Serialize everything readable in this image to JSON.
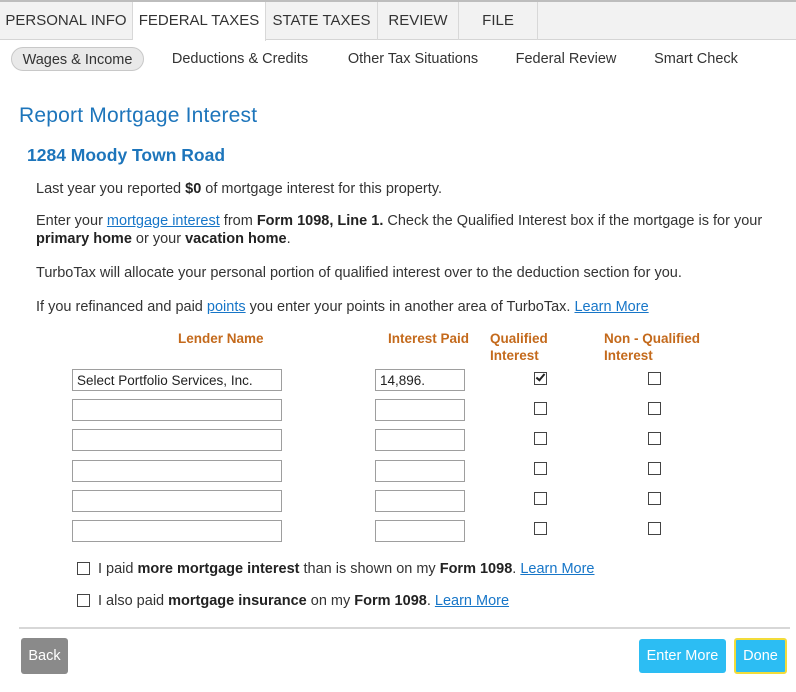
{
  "top_tabs": [
    {
      "label": "PERSONAL INFO"
    },
    {
      "label": "FEDERAL TAXES"
    },
    {
      "label": "STATE TAXES"
    },
    {
      "label": "REVIEW"
    },
    {
      "label": "FILE"
    }
  ],
  "sub_tabs": [
    {
      "label": "Wages & Income"
    },
    {
      "label": "Deductions & Credits"
    },
    {
      "label": "Other Tax Situations"
    },
    {
      "label": "Federal Review"
    },
    {
      "label": "Smart Check"
    }
  ],
  "page": {
    "title": "Report Mortgage Interest",
    "property": "1284 Moody Town Road"
  },
  "paragraphs": {
    "p1": {
      "pre": "Last year you reported ",
      "amount": "$0",
      "post": " of mortgage interest for this property."
    },
    "p2": {
      "pre": "Enter your ",
      "link": "mortgage interest",
      "mid": " from ",
      "form": "Form 1098, Line 1.",
      "mid2": " Check the Qualified Interest box if the mortgage is for your ",
      "primary": "primary home",
      "mid3": " or your ",
      "vacation": "vacation home",
      "end": "."
    },
    "p3": "TurboTax will allocate your personal portion of qualified interest over to the deduction section for you.",
    "p4": {
      "pre": "If you refinanced and paid ",
      "link": "points",
      "mid": " you enter your points in another area of TurboTax. ",
      "learn": "Learn More"
    }
  },
  "table": {
    "headers": {
      "lender": "Lender Name",
      "interest": "Interest Paid",
      "qualified_1": "Qualified",
      "qualified_2": "Interest",
      "nonqualified_1": "Non - Qualified",
      "nonqualified_2": "Interest"
    },
    "rows": [
      {
        "lender": "Select Portfolio Services, Inc.",
        "interest": "14,896.",
        "qualified": true,
        "nonqualified": false
      },
      {
        "lender": "",
        "interest": "",
        "qualified": false,
        "nonqualified": false
      },
      {
        "lender": "",
        "interest": "",
        "qualified": false,
        "nonqualified": false
      },
      {
        "lender": "",
        "interest": "",
        "qualified": false,
        "nonqualified": false
      },
      {
        "lender": "",
        "interest": "",
        "qualified": false,
        "nonqualified": false
      },
      {
        "lender": "",
        "interest": "",
        "qualified": false,
        "nonqualified": false
      }
    ]
  },
  "options": {
    "more_interest": {
      "pre": "I paid ",
      "bold1": "more mortgage interest",
      "mid": " than is shown on my ",
      "bold2": "Form 1098",
      "end": ". ",
      "learn": "Learn More",
      "checked": false
    },
    "insurance": {
      "pre": "I also paid ",
      "bold1": " mortgage insurance",
      "mid": " on my ",
      "bold2": "Form 1098",
      "end": ". ",
      "learn": "Learn More",
      "checked": false
    }
  },
  "buttons": {
    "back": "Back",
    "enter_more": "Enter More",
    "done": "Done"
  },
  "colors": {
    "accent_blue": "#1d75bb",
    "header_orange": "#c46a1c",
    "button_blue": "#2cbdf3",
    "button_gray": "#8a8a8a",
    "focus_yellow": "#f2dc3a"
  }
}
